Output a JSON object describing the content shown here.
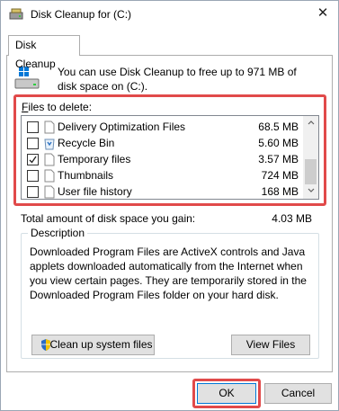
{
  "window": {
    "title": "Disk Cleanup for  (C:)",
    "close_symbol": "✕"
  },
  "tab": {
    "label": "Disk Cleanup"
  },
  "intro": {
    "text": "You can use Disk Cleanup to free up to 971 MB of disk space on  (C:)."
  },
  "files": {
    "label_prefix": "",
    "label_underlined": "F",
    "label_rest": "iles to delete:",
    "items": [
      {
        "name": "Delivery Optimization Files",
        "size": "68.5 MB",
        "checked": false,
        "icon": "blank-file-icon"
      },
      {
        "name": "Recycle Bin",
        "size": "5.60 MB",
        "checked": false,
        "icon": "recycle-bin-icon"
      },
      {
        "name": "Temporary files",
        "size": "3.57 MB",
        "checked": true,
        "icon": "blank-file-icon"
      },
      {
        "name": "Thumbnails",
        "size": "724 MB",
        "checked": false,
        "icon": "blank-file-icon"
      },
      {
        "name": "User file history",
        "size": "168 MB",
        "checked": false,
        "icon": "blank-file-icon"
      }
    ]
  },
  "total": {
    "label": "Total amount of disk space you gain:",
    "value": "4.03 MB"
  },
  "description": {
    "legend": "Description",
    "text": "Downloaded Program Files are ActiveX controls and Java applets downloaded automatically from the Internet when you view certain pages. They are temporarily stored in the Downloaded Program Files folder on your hard disk."
  },
  "buttons": {
    "cleanup_system": "Clean up system files",
    "view_files": "View Files",
    "ok": "OK",
    "cancel": "Cancel"
  },
  "colors": {
    "highlight": "#e14a4a",
    "button_face": "#e1e1e1",
    "focus_border": "#0078d7"
  }
}
